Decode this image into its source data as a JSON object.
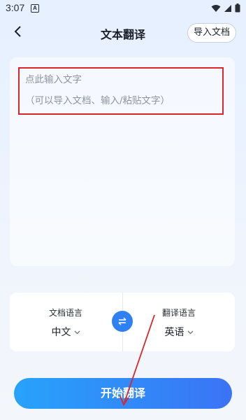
{
  "status_bar": {
    "time": "3:07",
    "app_icon_letter": "A"
  },
  "header": {
    "title": "文本翻译",
    "import_label": "导入文档"
  },
  "input": {
    "placeholder": "点此输入文字",
    "hint": "（可以导入文档、输入/粘贴文字）"
  },
  "language": {
    "source_label": "文档语言",
    "source_value": "中文",
    "target_label": "翻译语言",
    "target_value": "英语"
  },
  "actions": {
    "start_label": "开始翻译"
  },
  "colors": {
    "accent": "#2f80f3",
    "highlight": "#d9262c"
  }
}
